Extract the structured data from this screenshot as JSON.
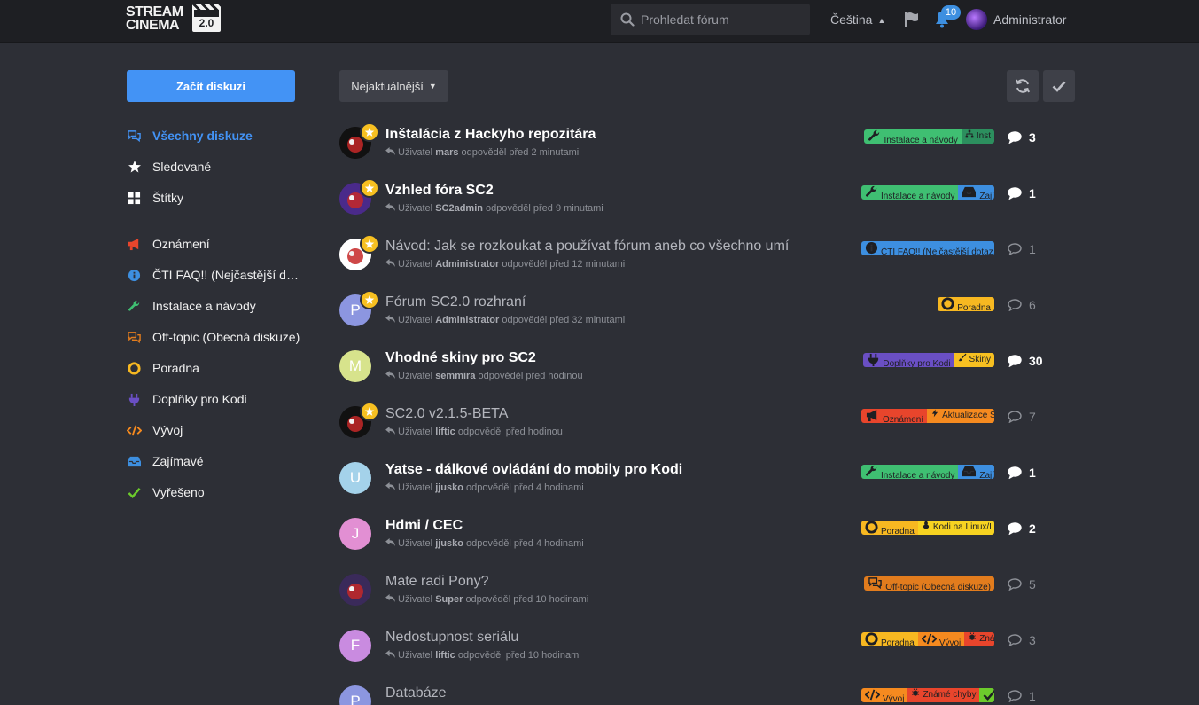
{
  "header": {
    "logo_line1": "STREAM",
    "logo_line2": "CINEMA",
    "logo_version": "2.0",
    "search_placeholder": "Prohledat fórum",
    "language": "Čeština",
    "notifications_count": "10",
    "user": "Administrator"
  },
  "sidebar": {
    "start_button": "Začít diskuzi",
    "items": [
      {
        "label": "Všechny diskuze",
        "icon": "comments-icon",
        "color": "#4393f5"
      },
      {
        "label": "Sledované",
        "icon": "star-icon",
        "color": "#ffffff"
      },
      {
        "label": "Štítky",
        "icon": "grid-icon",
        "color": "#ffffff"
      },
      {
        "label": "Oznámení",
        "icon": "megaphone-icon",
        "color": "#e8452c"
      },
      {
        "label": "ČTI FAQ!! (Nejčastější dot...",
        "icon": "info-icon",
        "color": "#3d8fe0"
      },
      {
        "label": "Instalace a návody",
        "icon": "wrench-icon",
        "color": "#3fbf72"
      },
      {
        "label": "Off-topic (Obecná diskuze)",
        "icon": "comments-icon",
        "color": "#e27c1d"
      },
      {
        "label": "Poradna",
        "icon": "lifebuoy-icon",
        "color": "#f7b821"
      },
      {
        "label": "Doplňky pro Kodi",
        "icon": "plug-icon",
        "color": "#6a4fc4"
      },
      {
        "label": "Vývoj",
        "icon": "code-icon",
        "color": "#f58a1f"
      },
      {
        "label": "Zajímavé",
        "icon": "inbox-icon",
        "color": "#3d8fe0"
      },
      {
        "label": "Vyřešeno",
        "icon": "check-icon",
        "color": "#6ccb2c"
      }
    ]
  },
  "toolbar": {
    "sort_label": "Nejaktuálnější"
  },
  "discussions": [
    {
      "title": "Inštalácia z Hackyho repozitára",
      "prefix": "Uživatel",
      "user": "mars",
      "action": "odpověděl před 2 minutami",
      "replies": "3",
      "unread": true,
      "avatar": "img",
      "avatar_bg": "#111111",
      "avatar_letter": "",
      "tags": [
        {
          "label": "Instalace a návody",
          "icon": "wrench-icon",
          "color": "#3fbf72"
        },
        {
          "label": "Inst",
          "icon": "sitemap-icon",
          "color": "#2c8f5e"
        }
      ]
    },
    {
      "title": "Vzhled fóra SC2",
      "prefix": "Uživatel",
      "user": "SC2admin",
      "action": "odpověděl před 9 minutami",
      "replies": "1",
      "unread": true,
      "avatar": "img",
      "avatar_bg": "#4a2a8a",
      "avatar_letter": "",
      "tags": [
        {
          "label": "Instalace a návody",
          "icon": "wrench-icon",
          "color": "#3fbf72"
        },
        {
          "label": "Zajím",
          "icon": "inbox-icon",
          "color": "#3d8fe0"
        }
      ]
    },
    {
      "title": "Návod: Jak se rozkoukat a používat fórum aneb co všechno umí",
      "prefix": "Uživatel",
      "user": "Administrator",
      "action": "odpověděl před 12 minutami",
      "replies": "1",
      "unread": false,
      "avatar": "img",
      "avatar_bg": "#ffffff",
      "avatar_letter": "",
      "tags": [
        {
          "label": "ČTI FAQ!! (Nejčastější dotaz",
          "icon": "info-icon",
          "color": "#3d8fe0"
        }
      ]
    },
    {
      "title": "Fórum SC2.0 rozhraní",
      "prefix": "Uživatel",
      "user": "Administrator",
      "action": "odpověděl před 32 minutami",
      "replies": "6",
      "unread": false,
      "avatar": "letter",
      "avatar_bg": "#8c96e0",
      "avatar_letter": "P",
      "tags": [
        {
          "label": "Poradna",
          "icon": "lifebuoy-icon",
          "color": "#f7b821"
        }
      ]
    },
    {
      "title": "Vhodné skiny pro SC2",
      "prefix": "Uživatel",
      "user": "semmira",
      "action": "odpověděl před hodinou",
      "replies": "30",
      "unread": true,
      "avatar": "letter",
      "avatar_bg": "#d7e38c",
      "avatar_letter": "M",
      "tags": [
        {
          "label": "Doplňky pro Kodi",
          "icon": "plug-icon",
          "color": "#6a4fc4"
        },
        {
          "label": "Skiny",
          "icon": "brush-icon",
          "color": "#f7c021"
        }
      ]
    },
    {
      "title": "SC2.0 v2.1.5-BETA",
      "prefix": "Uživatel",
      "user": "liftic",
      "action": "odpověděl před hodinou",
      "replies": "7",
      "unread": false,
      "avatar": "img",
      "avatar_bg": "#111111",
      "avatar_letter": "",
      "tags": [
        {
          "label": "Oznámení",
          "icon": "megaphone-icon",
          "color": "#e8452c"
        },
        {
          "label": "Aktualizace S",
          "icon": "bolt-icon",
          "color": "#f58a1f"
        }
      ]
    },
    {
      "title": "Yatse - dálkové ovládání do mobily pro Kodi",
      "prefix": "Uživatel",
      "user": "jjusko",
      "action": "odpověděl před 4 hodinami",
      "replies": "1",
      "unread": true,
      "avatar": "letter",
      "avatar_bg": "#a4d2ea",
      "avatar_letter": "U",
      "tags": [
        {
          "label": "Instalace a návody",
          "icon": "wrench-icon",
          "color": "#3fbf72"
        },
        {
          "label": "Zajím",
          "icon": "inbox-icon",
          "color": "#3d8fe0"
        }
      ]
    },
    {
      "title": "Hdmi / CEC",
      "prefix": "Uživatel",
      "user": "jjusko",
      "action": "odpověděl před 4 hodinami",
      "replies": "2",
      "unread": true,
      "avatar": "letter",
      "avatar_bg": "#e28fd3",
      "avatar_letter": "J",
      "tags": [
        {
          "label": "Poradna",
          "icon": "lifebuoy-icon",
          "color": "#f7b821"
        },
        {
          "label": "Kodi na Linux/L",
          "icon": "linux-icon",
          "color": "#f7d321"
        }
      ]
    },
    {
      "title": "Mate radi Pony?",
      "prefix": "Uživatel",
      "user": "Super",
      "action": "odpověděl před 10 hodinami",
      "replies": "5",
      "unread": false,
      "avatar": "img",
      "avatar_bg": "#3a2a5a",
      "avatar_letter": "",
      "tags": [
        {
          "label": "Off-topic (Obecná diskuze)",
          "icon": "comments-icon",
          "color": "#e27c1d"
        }
      ]
    },
    {
      "title": "Nedostupnost seriálu",
      "prefix": "Uživatel",
      "user": "liftic",
      "action": "odpověděl před 10 hodinami",
      "replies": "3",
      "unread": false,
      "avatar": "letter",
      "avatar_bg": "#c98be0",
      "avatar_letter": "F",
      "tags": [
        {
          "label": "Poradna",
          "icon": "lifebuoy-icon",
          "color": "#f7b821"
        },
        {
          "label": "Vývoj",
          "icon": "code-icon",
          "color": "#f58a1f"
        },
        {
          "label": "Zná",
          "icon": "bug-icon",
          "color": "#e8452c"
        }
      ]
    },
    {
      "title": "Databáze",
      "prefix": "",
      "user": "",
      "action": "",
      "replies": "1",
      "unread": false,
      "avatar": "letter",
      "avatar_bg": "#8c96e0",
      "avatar_letter": "P",
      "tags": [
        {
          "label": "Vývoj",
          "icon": "code-icon",
          "color": "#f58a1f"
        },
        {
          "label": "Známé chyby",
          "icon": "bug-icon",
          "color": "#e8452c"
        },
        {
          "label": "",
          "icon": "check-icon",
          "color": "#6ccb2c"
        }
      ]
    }
  ]
}
